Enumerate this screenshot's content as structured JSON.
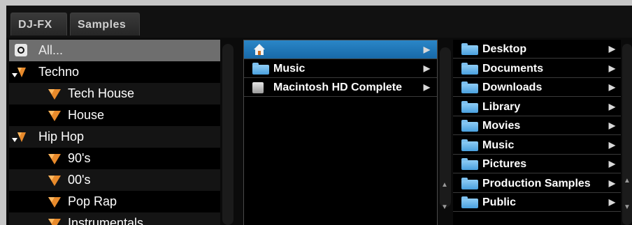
{
  "tabs": [
    {
      "label": "DJ-FX"
    },
    {
      "label": "Samples"
    }
  ],
  "genres": [
    {
      "label": "All...",
      "icon": "all-icon",
      "selected": true
    },
    {
      "label": "Techno",
      "icon": "genre-icon",
      "expanded": true
    },
    {
      "label": "Tech House",
      "icon": "genre-icon"
    },
    {
      "label": "House",
      "icon": "genre-icon"
    },
    {
      "label": "Hip Hop",
      "icon": "genre-icon",
      "expanded": true
    },
    {
      "label": "90's",
      "icon": "genre-icon"
    },
    {
      "label": "00's",
      "icon": "genre-icon"
    },
    {
      "label": "Pop Rap",
      "icon": "genre-icon"
    },
    {
      "label": "Instrumentals",
      "icon": "genre-icon"
    }
  ],
  "locations": [
    {
      "label": "",
      "icon": "home-icon",
      "highlighted": true
    },
    {
      "label": "Music",
      "icon": "folder-icon"
    },
    {
      "label": "Macintosh HD Complete",
      "icon": "hard-drive-icon"
    }
  ],
  "folders": [
    {
      "label": "Desktop"
    },
    {
      "label": "Documents"
    },
    {
      "label": "Downloads"
    },
    {
      "label": "Library"
    },
    {
      "label": "Movies"
    },
    {
      "label": "Music"
    },
    {
      "label": "Pictures"
    },
    {
      "label": "Production Samples"
    },
    {
      "label": "Public"
    }
  ],
  "arrow_glyph": "▶",
  "colors": {
    "highlight": "#1f77b8",
    "selected_row": "#6e6e6e",
    "genre_orange": "#e88a2b"
  }
}
